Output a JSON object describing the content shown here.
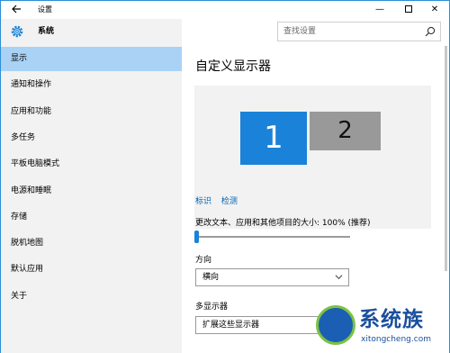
{
  "window": {
    "title": "设置",
    "controls": {
      "minimize": "—",
      "close": "✕"
    }
  },
  "sidebar": {
    "header": "系统",
    "items": [
      {
        "label": "显示",
        "active": true
      },
      {
        "label": "通知和操作"
      },
      {
        "label": "应用和功能"
      },
      {
        "label": "多任务"
      },
      {
        "label": "平板电脑模式"
      },
      {
        "label": "电源和睡眠"
      },
      {
        "label": "存储"
      },
      {
        "label": "脱机地图"
      },
      {
        "label": "默认应用"
      },
      {
        "label": "关于"
      }
    ]
  },
  "search": {
    "placeholder": "查找设置"
  },
  "main": {
    "title": "自定义显示器",
    "monitors": [
      "1",
      "2"
    ],
    "links": {
      "identify": "标识",
      "detect": "检测"
    },
    "scale": {
      "label": "更改文本、应用和其他项目的大小: 100% (推荐)",
      "value": 0
    },
    "orientation": {
      "label": "方向",
      "value": "横向"
    },
    "multi_display": {
      "label": "多显示器",
      "value": "扩展这些显示器"
    }
  },
  "watermark": {
    "text": "系统族",
    "url": "xitongcheng.com"
  },
  "colors": {
    "accent": "#1a82d8",
    "sidebar_active": "#a9d2f5",
    "link": "#0063b1"
  }
}
